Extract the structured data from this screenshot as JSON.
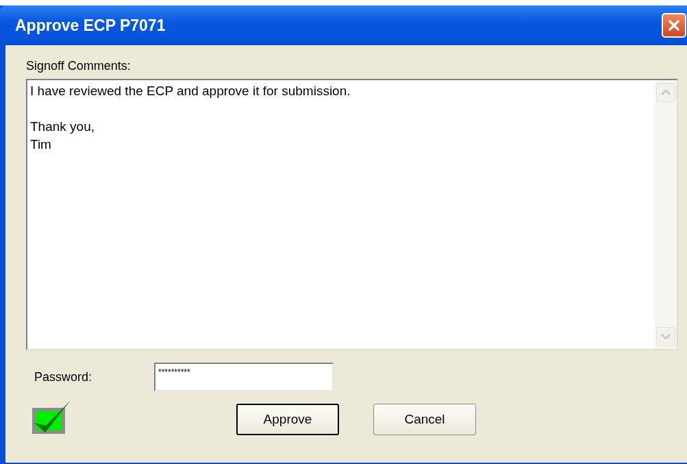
{
  "window": {
    "title": "Approve ECP P7071"
  },
  "comments": {
    "label": "Signoff Comments:",
    "value": "I have reviewed the ECP and approve it for submission.\n\nThank you,\nTim"
  },
  "password": {
    "label": "Password:",
    "value": "**********"
  },
  "approved": {
    "checked": true
  },
  "buttons": [
    {
      "label": "Approve",
      "kind": "default"
    },
    {
      "label": "Cancel",
      "kind": "normal"
    }
  ]
}
